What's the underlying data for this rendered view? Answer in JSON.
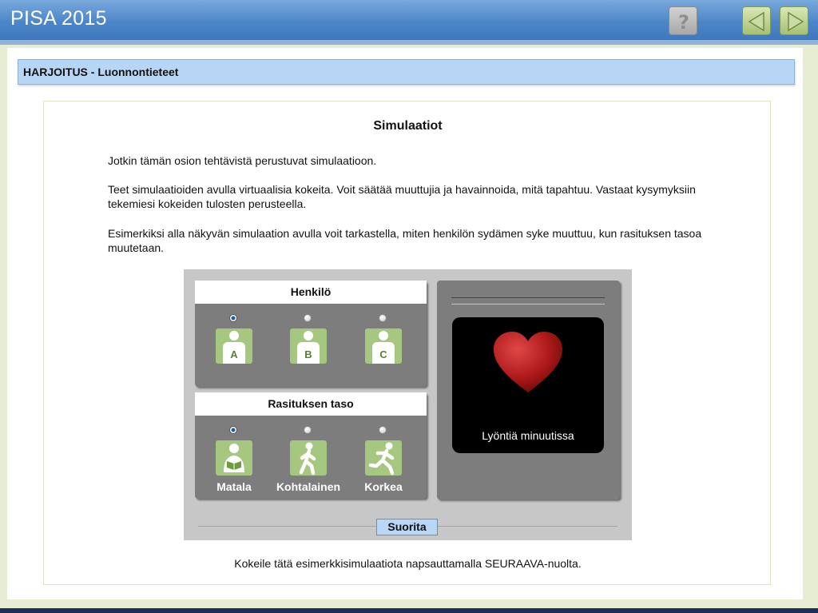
{
  "app": {
    "title": "PISA 2015"
  },
  "toolbar": {
    "help_icon": "question-mark-icon",
    "prev_icon": "left-arrow-icon",
    "next_icon": "right-arrow-icon",
    "help_color": "#b8b8b8",
    "nav_color": "#a6c072"
  },
  "section": {
    "title": "HARJOITUS - Luonnontieteet"
  },
  "page": {
    "title": "Simulaatiot",
    "paragraphs": [
      "Jotkin tämän osion tehtävistä perustuvat simulaatioon.",
      "Teet simulaatioiden avulla virtuaalisia kokeita. Voit säätää muuttujia ja havainnoida, mitä tapahtuu. Vastaat kysymyksiin tekemiesi kokeiden tulosten perusteella.",
      "Esimerkiksi alla näkyvän simulaation avulla voit tarkastella, miten henkilön sydämen syke muuttuu, kun rasituksen tasoa muutetaan."
    ],
    "footer": "Kokeile tätä esimerkkisimulaatiota napsauttamalla SEURAAVA-nuolta."
  },
  "simulation": {
    "person": {
      "heading": "Henkilö",
      "options": [
        {
          "letter": "A",
          "icon": "person-icon",
          "selected": true
        },
        {
          "letter": "B",
          "icon": "person-icon",
          "selected": false
        },
        {
          "letter": "C",
          "icon": "person-icon",
          "selected": false
        }
      ]
    },
    "effort": {
      "heading": "Rasituksen taso",
      "options": [
        {
          "label": "Matala",
          "icon": "reading-person-icon",
          "selected": true
        },
        {
          "label": "Kohtalainen",
          "icon": "walking-person-icon",
          "selected": false
        },
        {
          "label": "Korkea",
          "icon": "running-person-icon",
          "selected": false
        }
      ]
    },
    "monitor": {
      "icon": "heart-icon",
      "label": "Lyöntiä minuutissa",
      "heart_color": "#b01a1a",
      "screen_color": "#000000"
    },
    "run_button": "Suorita"
  }
}
